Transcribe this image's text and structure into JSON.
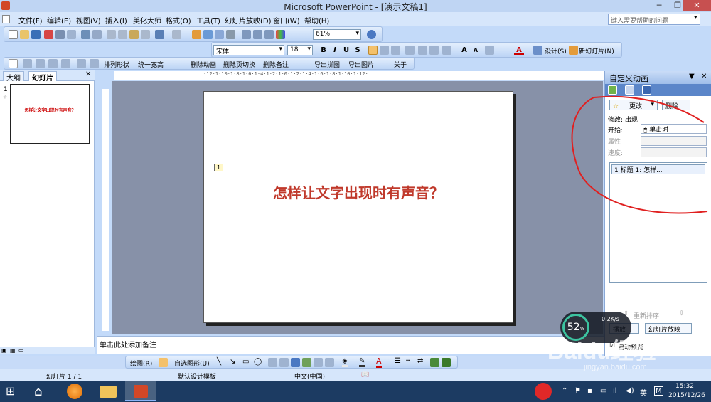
{
  "window": {
    "title": "Microsoft PowerPoint - [演示文稿1]"
  },
  "menu": {
    "items": [
      "文件(F)",
      "编辑(E)",
      "视图(V)",
      "插入(I)",
      "美化大师",
      "格式(O)",
      "工具(T)",
      "幻灯片放映(D)",
      "窗口(W)",
      "帮助(H)"
    ],
    "help_placeholder": "键入需要帮助的问题"
  },
  "toolbar": {
    "zoom": "61%",
    "font_name": "宋体",
    "font_size": "18",
    "bold": "B",
    "italic": "I",
    "underline": "U",
    "shadow": "S",
    "design_label": "设计(S)",
    "new_slide_label": "新幻灯片(N)",
    "grow_font": "A",
    "shrink_font": "A"
  },
  "toolbar2": {
    "items": [
      "排列形状",
      "统一宽高",
      "删除动画",
      "删除页切换",
      "删除备注",
      "导出拼图",
      "导出图片",
      "关于"
    ]
  },
  "left_pane": {
    "tabs": [
      "大纲",
      "幻灯片"
    ],
    "slide_number": "1",
    "thumb_title": "怎样让文字出现时有声音？"
  },
  "ruler": {
    "text": "·12·1·10·1·8·1·6·1·4·1·2·1·0·1·2·1·4·1·6·1·8·1·10·1·12·"
  },
  "slide": {
    "title": "怎样让文字出现时有声音？",
    "anim_tag": "1"
  },
  "notes": {
    "placeholder": "单击此处添加备注"
  },
  "task_pane": {
    "title": "自定义动画",
    "change_btn": "更改",
    "delete_btn": "删除",
    "modify_label": "修改: 出现",
    "start_label": "开始:",
    "start_value": "单击时",
    "property_label": "属性",
    "speed_label": "速度:",
    "anim_item": "1 标题 1: 怎样...",
    "reorder_label": "重新排序",
    "play_btn": "播放",
    "slideshow_btn": "幻灯片放映",
    "autopreview_label": "自动预览"
  },
  "draw_toolbar": {
    "draw_label": "绘图(R)",
    "autoshape_label": "自选图形(U)"
  },
  "status": {
    "slide_pos": "幻灯片 1 / 1",
    "template": "默认设计模板",
    "language": "中文(中国)"
  },
  "net_widget": {
    "percent": "52",
    "pct_sign": "%",
    "speed": "0.2K/s"
  },
  "watermark": {
    "brand": "Baidu经验",
    "url": "jingyan.baidu.com"
  },
  "taskbar": {
    "time": "15:32",
    "date": "2015/12/26",
    "ime": "英",
    "ime2": "M"
  }
}
